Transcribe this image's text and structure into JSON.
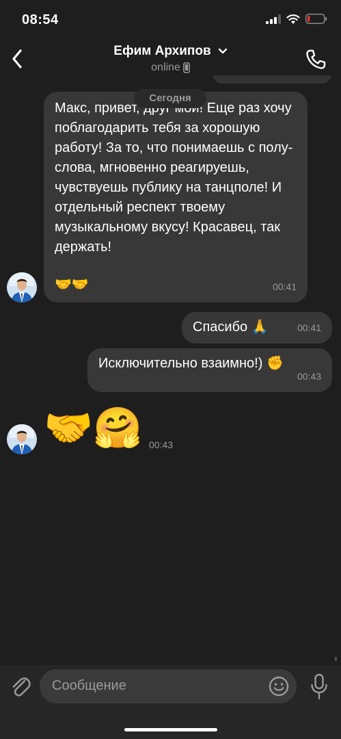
{
  "status_bar": {
    "time": "08:54",
    "battery_level": 0.15,
    "battery_color": "#e53935"
  },
  "header": {
    "name": "Ефим Архипов",
    "status": "online"
  },
  "date_divider": "Сегодня",
  "messages": [
    {
      "direction": "incoming",
      "text": "Макс, привет, друг мой! Еще раз хочу поблагодарить тебя за хорошую работу! За то, что понимаешь с полу-слова, мгновенно реагируешь, чувствуешь публику на танцполе! И отдельный респект твоему музыкальному вкусу! Красавец, так держать!",
      "emoji": "🤝🤝",
      "time": "00:41"
    },
    {
      "direction": "outgoing",
      "text": "Спасибо",
      "emoji": "🙏",
      "time": "00:41"
    },
    {
      "direction": "outgoing",
      "text": "Исключительно взаимно!)",
      "emoji": "✊",
      "time": "00:43"
    },
    {
      "direction": "incoming",
      "emoji": "🤝🤗",
      "time": "00:43"
    }
  ],
  "composer": {
    "placeholder": "Сообщение"
  },
  "colors": {
    "background": "#1e1e1e",
    "bubble": "#383838",
    "input": "#3a3a3a",
    "muted_text": "#9a9a9a"
  },
  "icons": [
    "back-arrow-icon",
    "chevron-down-icon",
    "phone-call-icon",
    "mobile-device-icon",
    "paperclip-icon",
    "emoji-smile-icon",
    "microphone-icon",
    "signal-icon",
    "wifi-icon",
    "battery-icon"
  ]
}
